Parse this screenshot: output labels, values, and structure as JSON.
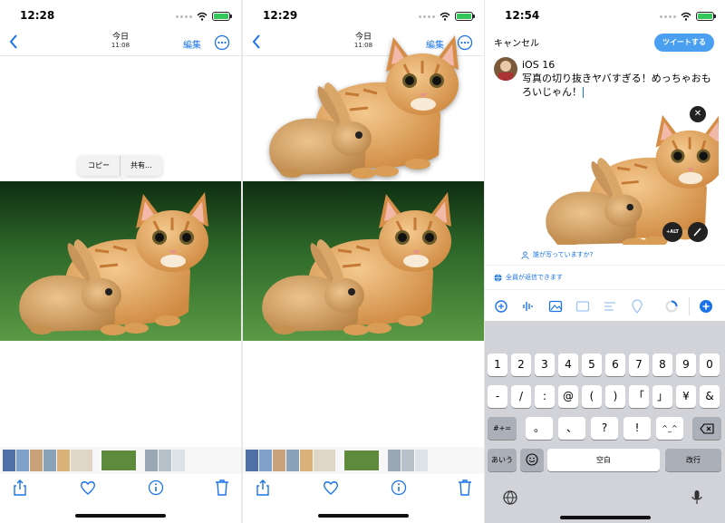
{
  "photos_1": {
    "status": {
      "time": "12:28"
    },
    "nav": {
      "title": "今日",
      "subtitle": "11:08",
      "edit_label": "編集"
    },
    "context_menu": {
      "items": [
        "コピー",
        "共有..."
      ]
    }
  },
  "photos_2": {
    "status": {
      "time": "12:29"
    },
    "nav": {
      "title": "今日",
      "subtitle": "11:08",
      "edit_label": "編集"
    }
  },
  "twitter": {
    "status": {
      "time": "12:54"
    },
    "cancel_label": "キャンセル",
    "tweet_button": "ツイートする",
    "tweet_text": "iOS 16\n写真の切り抜きヤバすぎる！めっちゃおもろいじゃん！",
    "alt_label": "+ALT",
    "tag_people": "誰が写っていますか?",
    "reply_setting": "全員が返信できます",
    "accent_color": "#1d9bf0"
  },
  "keyboard": {
    "row1": [
      "1",
      "2",
      "3",
      "4",
      "5",
      "6",
      "7",
      "8",
      "9",
      "0"
    ],
    "row2": [
      "-",
      "/",
      ":",
      "@",
      "(",
      ")",
      "「",
      "」",
      "¥",
      "&"
    ],
    "row3_left": "#+=",
    "row3": [
      "。",
      "、",
      "?",
      "!",
      "^_^"
    ],
    "lang_key": "あいう",
    "space": "空白",
    "return": "改行"
  },
  "icons": [
    "back-chevron-icon",
    "more-icon",
    "share-icon",
    "heart-icon",
    "info-icon",
    "trash-icon",
    "gif-icon",
    "voice-icon",
    "image-icon",
    "location-icon",
    "add-icon",
    "globe-icon",
    "mic-icon",
    "emoji-icon",
    "delete-icon"
  ]
}
